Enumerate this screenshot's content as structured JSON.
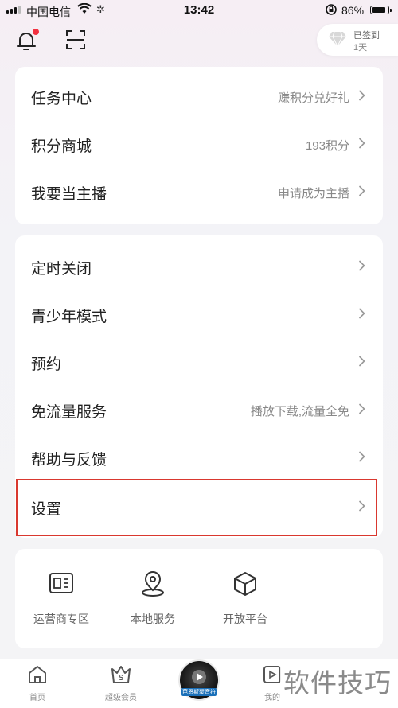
{
  "status_bar": {
    "carrier": "中国电信",
    "time": "13:42",
    "battery": "86%",
    "battery_level": 0.86
  },
  "header": {
    "sign_in_status": "已签到",
    "sign_in_days": "1天"
  },
  "card_top": [
    {
      "label": "任务中心",
      "sub": "赚积分兑好礼"
    },
    {
      "label": "积分商城",
      "sub": "193积分"
    },
    {
      "label": "我要当主播",
      "sub": "申请成为主播"
    }
  ],
  "card_settings": [
    {
      "label": "定时关闭",
      "sub": ""
    },
    {
      "label": "青少年模式",
      "sub": ""
    },
    {
      "label": "预约",
      "sub": ""
    },
    {
      "label": "免流量服务",
      "sub": "播放下载,流量全免"
    },
    {
      "label": "帮助与反馈",
      "sub": ""
    },
    {
      "label": "设置",
      "sub": ""
    }
  ],
  "services": [
    {
      "label": "运营商专区",
      "icon": "sim-card-icon"
    },
    {
      "label": "本地服务",
      "icon": "location-pin-icon"
    },
    {
      "label": "开放平台",
      "icon": "cube-icon"
    }
  ],
  "bottom_nav": {
    "home": "首页",
    "vip": "超级会员",
    "play_badge": "芭恩斯聚音符",
    "mine": "我的"
  },
  "watermark": "软件技巧",
  "colors": {
    "highlight_box": "#d9382f",
    "notification_dot": "#f2303f"
  }
}
